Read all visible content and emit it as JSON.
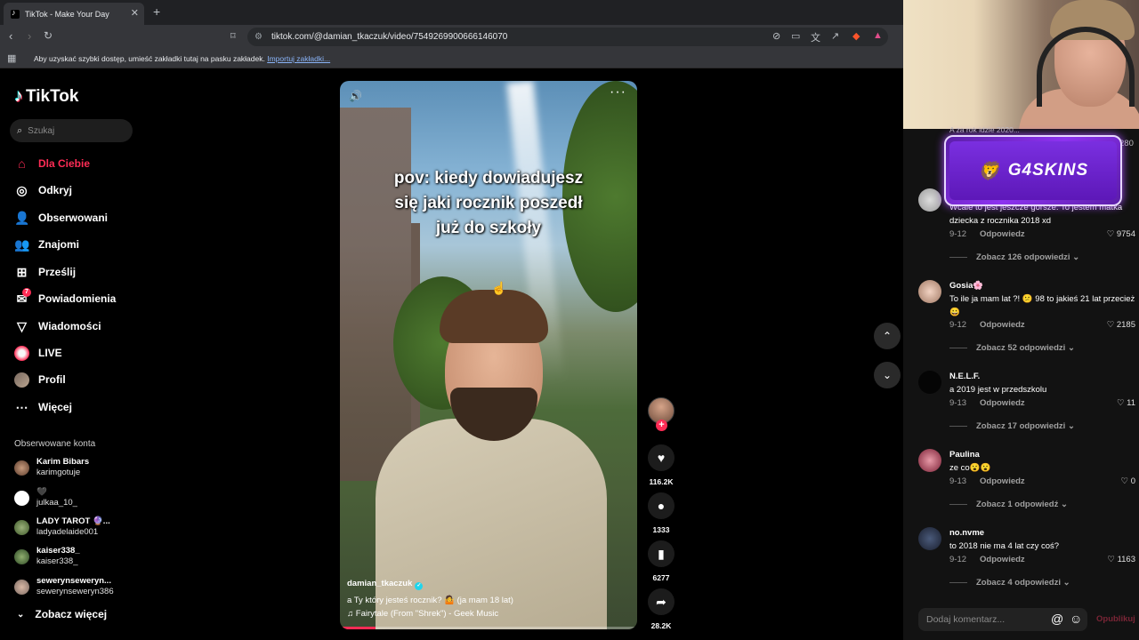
{
  "browser": {
    "tab_title": "TikTok - Make Your Day",
    "url": "tiktok.com/@damian_tkaczuk/video/7549269900666146070",
    "bookmarks_hint": "Aby uzyskać szybki dostęp, umieść zakładki tutaj na pasku zakładek.",
    "bookmarks_import": "Importuj zakładki..."
  },
  "sidebar": {
    "logo": "TikTok",
    "search_placeholder": "Szukaj",
    "nav": [
      {
        "label": "Dla Ciebie",
        "icon": "home-icon",
        "active": true
      },
      {
        "label": "Odkryj",
        "icon": "compass-icon"
      },
      {
        "label": "Obserwowani",
        "icon": "following-icon"
      },
      {
        "label": "Znajomi",
        "icon": "friends-icon"
      },
      {
        "label": "Prześlij",
        "icon": "upload-icon"
      },
      {
        "label": "Powiadomienia",
        "icon": "notifications-icon",
        "badge": "7"
      },
      {
        "label": "Wiadomości",
        "icon": "messages-icon"
      },
      {
        "label": "LIVE",
        "icon": "live-icon"
      },
      {
        "label": "Profil",
        "icon": "profile-avatar"
      },
      {
        "label": "Więcej",
        "icon": "more-icon"
      }
    ],
    "followed_heading": "Obserwowane konta",
    "accounts": [
      {
        "name": "Karim Bibars",
        "handle": "karimgotuje"
      },
      {
        "name": "🖤",
        "handle": "julkaa_10_"
      },
      {
        "name": "LADY TAROT 🔮...",
        "handle": "ladyadelaide001"
      },
      {
        "name": "kaiser338_",
        "handle": "kaiser338_"
      },
      {
        "name": "sewerynseweryn...",
        "handle": "sewerynseweryn386"
      }
    ],
    "see_more": "Zobacz więcej"
  },
  "video": {
    "caption_lines": [
      "pov: kiedy dowiadujesz",
      "się jaki rocznik poszedł",
      "już do szkoły"
    ],
    "author": "damian_tkaczuk",
    "description": "a Ty który jesteś rocznik? 🤷 (ja mam 18 lat)",
    "music": "♫ Fairytale (From \"Shrek\") - Geek Music",
    "progress": 0.12
  },
  "actions": {
    "likes": "116.2K",
    "comments": "1333",
    "saves": "6277",
    "shares": "28.2K"
  },
  "overlay": {
    "badge_text": "G4SKINS"
  },
  "comments_panel": {
    "partial_text": "A za rok idzie 2020...",
    "partial_likes": "280",
    "items": [
      {
        "name": "",
        "text": "Wcale to jest jeszcze gorsze. To jestem matka dziecka z rocznika 2018 xd",
        "date": "9-12",
        "reply": "Odpowiedz",
        "likes": "9754",
        "more": "Zobacz 126 odpowiedzi"
      },
      {
        "name": "Gosia🌸",
        "text": "To ile ja mam lat ?! 😕 98 to jakieś 21 lat przecież 😀",
        "date": "9-12",
        "reply": "Odpowiedz",
        "likes": "2185",
        "more": "Zobacz 52 odpowiedzi"
      },
      {
        "name": "N.E.L.F.",
        "text": "a 2019 jest w przedszkolu",
        "date": "9-13",
        "reply": "Odpowiedz",
        "likes": "11",
        "more": "Zobacz 17 odpowiedzi"
      },
      {
        "name": "Paulina",
        "text": "ze co😮😮",
        "date": "9-13",
        "reply": "Odpowiedz",
        "likes": "0",
        "more": "Zobacz 1 odpowiedź"
      },
      {
        "name": "no.nvme",
        "text": "to 2018 nie ma 4 lat czy coś?",
        "date": "9-12",
        "reply": "Odpowiedz",
        "likes": "1163",
        "more": "Zobacz 4 odpowiedzi"
      }
    ],
    "input_placeholder": "Dodaj komentarz...",
    "publish_label": "Opublikuj"
  }
}
